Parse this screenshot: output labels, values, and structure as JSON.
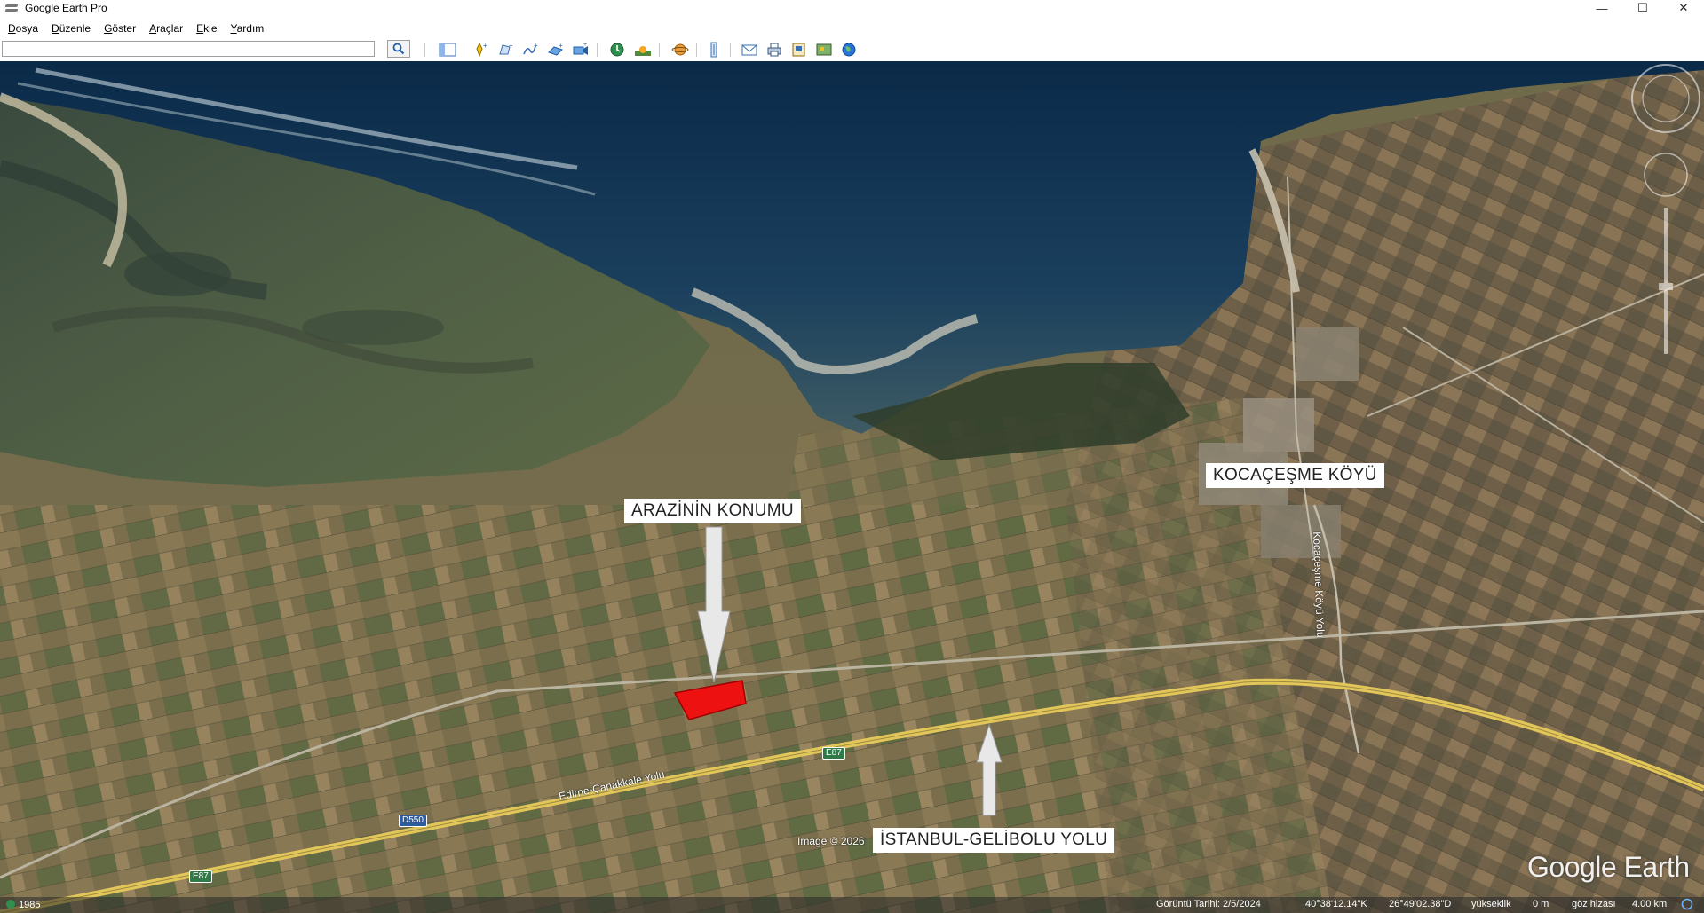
{
  "window": {
    "title": "Google Earth Pro",
    "minimize": "—",
    "maximize": "☐",
    "close": "✕"
  },
  "menu": {
    "items": [
      {
        "accel": "D",
        "rest": "osya"
      },
      {
        "accel": "D",
        "rest": "üzenle"
      },
      {
        "accel": "G",
        "rest": "öster"
      },
      {
        "accel": "A",
        "rest": "raçlar"
      },
      {
        "accel": "E",
        "rest": "kle"
      },
      {
        "accel": "Y",
        "rest": "ardım"
      }
    ]
  },
  "search": {
    "value": "",
    "placeholder": ""
  },
  "toolbar_icons": [
    "sidebar-toggle-icon",
    "placemark-icon",
    "polygon-icon",
    "path-icon",
    "image-overlay-icon",
    "record-tour-icon",
    "historical-imagery-icon",
    "sunlight-icon",
    "planets-icon",
    "ruler-icon",
    "email-icon",
    "print-icon",
    "save-image-icon",
    "view-in-maps-icon",
    "earth-icon"
  ],
  "map_labels": {
    "property": "ARAZİNİN KONUMU",
    "village": "KOCAÇEŞME KÖYÜ",
    "highway": "İSTANBUL-GELİBOLU YOLU"
  },
  "roads": {
    "edirne": "Edirne-Çanakkale Yolu",
    "kocacesme": "Kocaçeşme Köyü Yolu",
    "e87_a": "E87",
    "e87_b": "E87",
    "d550": "D550"
  },
  "image_credit": "Image © 2026",
  "watermark": "Google Earth",
  "status": {
    "year": "1985",
    "imagery_date_label": "Görüntü Tarihi: 2/5/2024",
    "lat": "40°38'12.14\"K",
    "lon": "26°49'02.38\"D",
    "elevation_label": "yükseklik",
    "elevation_value": "0 m",
    "eye_label": "göz hizası",
    "eye_value": "4.00 km"
  },
  "colors": {
    "property_fill": "#ee1111",
    "highway": "#e3c65a",
    "sea_deep": "#0d2a45",
    "land": "#6b6a48"
  }
}
